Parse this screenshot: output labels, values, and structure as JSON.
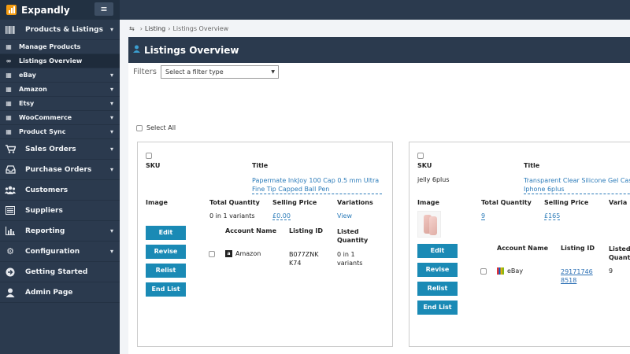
{
  "app": {
    "name": "Expandly"
  },
  "sidebar": {
    "items": [
      {
        "label": "Products & Listings",
        "icon": "barcode-icon",
        "caret": true
      },
      {
        "label": "Manage Products",
        "icon": "grid-icon",
        "sub": true
      },
      {
        "label": "Listings Overview",
        "icon": "link-icon",
        "sub": true,
        "active": true
      },
      {
        "label": "eBay",
        "icon": "grid-icon",
        "sub": true,
        "caret": true
      },
      {
        "label": "Amazon",
        "icon": "grid-icon",
        "sub": true,
        "caret": true
      },
      {
        "label": "Etsy",
        "icon": "grid-icon",
        "sub": true,
        "caret": true
      },
      {
        "label": "WooCommerce",
        "icon": "grid-icon",
        "sub": true,
        "caret": true
      },
      {
        "label": "Product Sync",
        "icon": "grid-icon",
        "sub": true,
        "caret": true
      },
      {
        "label": "Sales Orders",
        "icon": "cart-icon",
        "caret": true
      },
      {
        "label": "Purchase Orders",
        "icon": "inbox-icon",
        "caret": true
      },
      {
        "label": "Customers",
        "icon": "users-icon"
      },
      {
        "label": "Suppliers",
        "icon": "list-icon"
      },
      {
        "label": "Reporting",
        "icon": "chart-icon",
        "caret": true
      },
      {
        "label": "Configuration",
        "icon": "gears-icon",
        "caret": true
      },
      {
        "label": "Getting Started",
        "icon": "arrow-circle-icon"
      },
      {
        "label": "Admin Page",
        "icon": "user-icon"
      }
    ]
  },
  "breadcrumb": {
    "link": "Listing",
    "current": "Listings Overview"
  },
  "page": {
    "title": "Listings Overview"
  },
  "filters": {
    "label": "Filters",
    "select_value": "Select a filter type"
  },
  "select_all_label": "Select All",
  "card_labels": {
    "sku": "SKU",
    "title": "Title",
    "image": "Image",
    "total_quantity": "Total Quantity",
    "selling_price": "Selling Price",
    "variations": "Variations",
    "account_name": "Account Name",
    "listing_id": "Listing ID",
    "listed_quantity": "Listed Quantity",
    "edit": "Edit",
    "revise": "Revise",
    "relist": "Relist",
    "end_list": "End List"
  },
  "cards": [
    {
      "sku": "",
      "title": "Papermate InkJoy 100 Cap 0.5 mm Ultra Fine Tip Capped Ball Pen",
      "total_quantity": "0 in 1 variants",
      "selling_price": "£0.00",
      "variations": "View",
      "account_name": "Amazon",
      "listing_id": "B077ZNK K74",
      "listed_quantity": "0 in 1 variants"
    },
    {
      "sku": "jelly 6plus",
      "title": "Transparent Clear Silicone Gel Cas Iphone 6plus",
      "total_quantity": "9",
      "selling_price": "£165",
      "variations": "Varia",
      "account_name": "eBay",
      "listing_id": "29171746 8518",
      "listed_quantity": "9"
    }
  ]
}
